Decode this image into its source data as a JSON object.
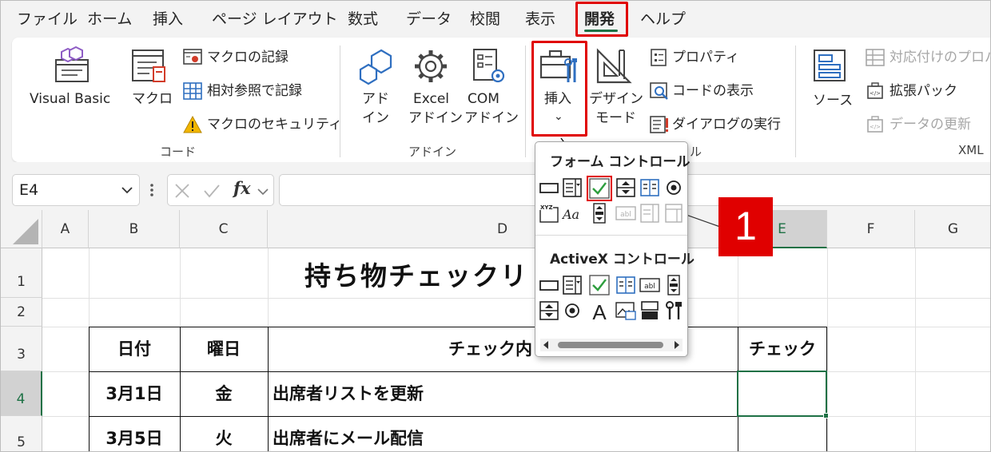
{
  "menu": {
    "tabs": [
      "ファイル",
      "ホーム",
      "挿入",
      "ページ レイアウト",
      "数式",
      "データ",
      "校閲",
      "表示",
      "開発",
      "ヘルプ"
    ],
    "active_tab": "開発"
  },
  "ribbon": {
    "code": {
      "visual_basic": "Visual Basic",
      "macro": "マクロ",
      "record_macro": "マクロの記録",
      "relative_ref": "相対参照で記録",
      "macro_security": "マクロのセキュリティ",
      "label": "コード"
    },
    "addins": {
      "addin_line1": "アド",
      "addin_line2": "イン",
      "excel_addin_line1": "Excel",
      "excel_addin_line2": "アドイン",
      "com_addin_line1": "COM",
      "com_addin_line2": "アドイン",
      "label": "アドイン"
    },
    "controls": {
      "insert": "挿入",
      "insert_caret": "⌄",
      "design_mode_line1": "デザイン",
      "design_mode_line2": "モード",
      "properties": "プロパティ",
      "view_code": "コードの表示",
      "run_dialog": "ダイアログの実行",
      "label_fragment": "ル"
    },
    "xml": {
      "source": "ソース",
      "map_properties": "対応付けのプロパ",
      "expansion_packs": "拡張パック",
      "refresh_data": "データの更新",
      "label": "XML"
    }
  },
  "formula_bar": {
    "name_box": "E4",
    "fx": "fx",
    "value": ""
  },
  "sheet": {
    "columns": [
      "A",
      "B",
      "C",
      "D",
      "E",
      "F",
      "G"
    ],
    "rows": [
      "1",
      "2",
      "3",
      "4",
      "5"
    ],
    "title": "持ち物チェックリ",
    "headers": {
      "date": "日付",
      "weekday": "曜日",
      "content": "チェック内",
      "check": "チェック"
    },
    "data_rows": [
      {
        "date": "3月1日",
        "weekday": "金",
        "content": "出席者リストを更新"
      },
      {
        "date": "3月5日",
        "weekday": "火",
        "content": "出席者にメール配信"
      }
    ]
  },
  "insert_dropdown": {
    "form_controls_title": "フォーム コントロール",
    "activex_title": "ActiveX コントロール",
    "xyz_label": "XYZ",
    "aa_label": "Aa",
    "abl_label": "abl",
    "a_label": "A"
  },
  "callout": {
    "number": "1"
  },
  "colors": {
    "accent": "#1e7145",
    "highlight": "#e00000",
    "check": "#2e9e3e"
  }
}
